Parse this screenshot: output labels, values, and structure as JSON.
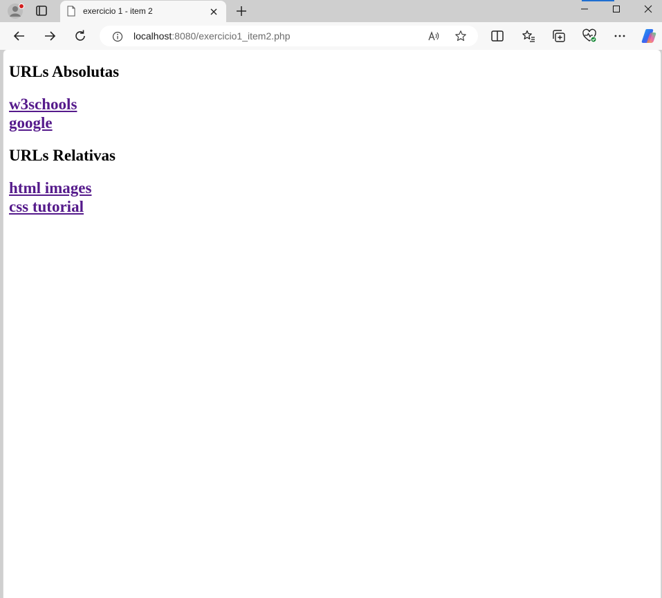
{
  "tab": {
    "title": "exercicio 1 - item 2"
  },
  "address_bar": {
    "host": "localhost",
    "path": ":8080/exercicio1_item2.php"
  },
  "icons": {
    "profile": "profile-avatar-icon",
    "tab_actions": "tab-actions-icon",
    "page": "page-icon",
    "tab_close": "close-icon",
    "new_tab": "plus-icon",
    "minimize": "minimize-icon",
    "maximize": "maximize-icon",
    "close_window": "close-icon",
    "back": "arrow-left-icon",
    "forward": "arrow-right-icon",
    "refresh": "refresh-icon",
    "site_info": "info-icon",
    "read_aloud": "read-aloud-icon",
    "favorite": "star-icon",
    "split_screen": "split-screen-icon",
    "favorites": "favorites-list-icon",
    "collections": "collections-icon",
    "browser_essentials": "heart-pulse-icon",
    "more": "more-dots-icon",
    "copilot": "copilot-icon"
  },
  "colors": {
    "link_visited": "#551a8b",
    "accent": "#1f6fd1"
  },
  "page": {
    "absolute_heading": "URLs Absolutas",
    "absolute_links": [
      {
        "label": "w3schools"
      },
      {
        "label": "google"
      }
    ],
    "relative_heading": "URLs Relativas",
    "relative_links": [
      {
        "label": "html images"
      },
      {
        "label": "css tutorial"
      }
    ]
  }
}
